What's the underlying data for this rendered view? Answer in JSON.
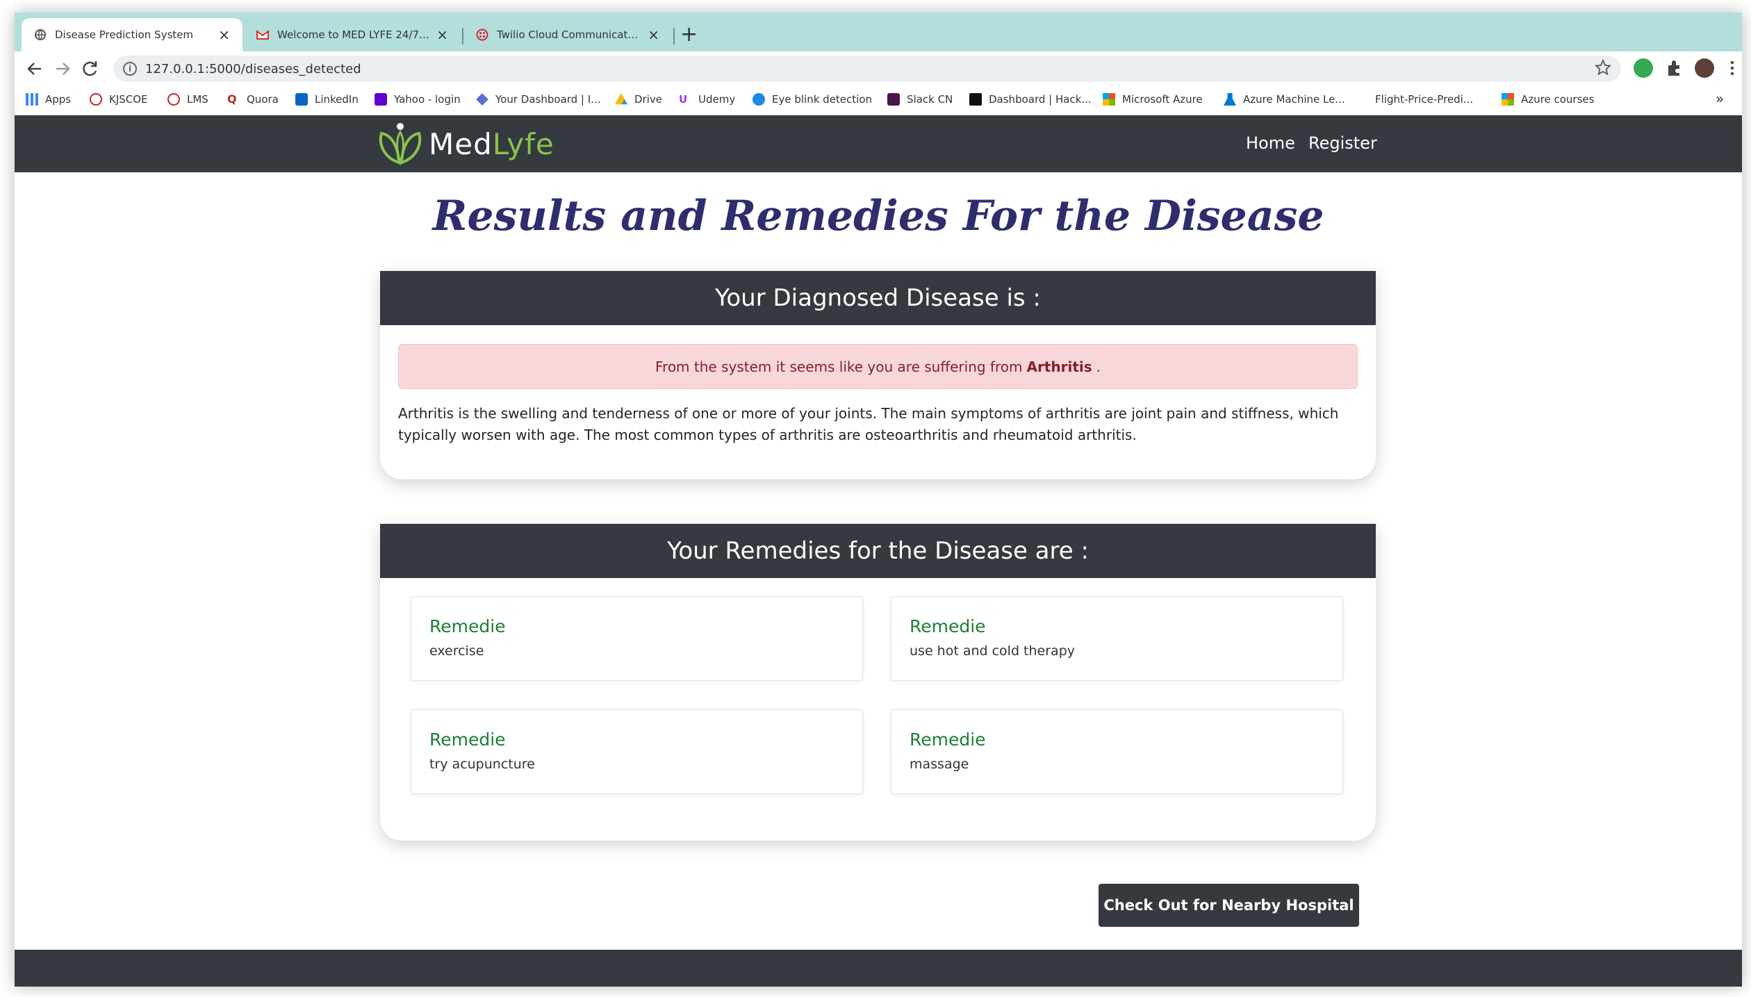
{
  "browser": {
    "tabs": [
      {
        "title": "Disease Prediction System"
      },
      {
        "title": "Welcome to MED LYFE 24/7 - I"
      },
      {
        "title": "Twilio Cloud Communications |"
      }
    ],
    "new_tab": "+",
    "close_glyph": "×",
    "url": "127.0.0.1:5000/diseases_detected",
    "bookmarks": [
      {
        "label": "Apps"
      },
      {
        "label": "KJSCOE"
      },
      {
        "label": "LMS"
      },
      {
        "label": "Quora"
      },
      {
        "label": "LinkedIn"
      },
      {
        "label": "Yahoo - login"
      },
      {
        "label": "Your Dashboard | I..."
      },
      {
        "label": "Drive"
      },
      {
        "label": "Udemy"
      },
      {
        "label": "Eye blink detection"
      },
      {
        "label": "Slack CN"
      },
      {
        "label": "Dashboard | Hack..."
      },
      {
        "label": "Microsoft Azure"
      },
      {
        "label": "Azure Machine Le..."
      },
      {
        "label": "Flight-Price-Predi..."
      },
      {
        "label": "Azure courses"
      }
    ],
    "more_bookmarks": "»"
  },
  "site": {
    "logo_part1": "Med",
    "logo_part2": "Lyfe",
    "nav_home": "Home",
    "nav_register": "Register"
  },
  "main": {
    "title": "Results and Remedies For the Disease",
    "diagnosis_header": "Your Diagnosed Disease is :",
    "alert_prefix": "From the system it seems like you are suffering from",
    "disease": "Arthritis",
    "alert_suffix": ".",
    "description": "Arthritis is the swelling and tenderness of one or more of your joints. The main symptoms of arthritis are joint pain and stiffness, which typically worsen with age. The most common types of arthritis are osteoarthritis and rheumatoid arthritis.",
    "remedies_header": "Your Remedies for the Disease are :",
    "remedies": [
      {
        "title": "Remedie",
        "value": "exercise"
      },
      {
        "title": "Remedie",
        "value": "use hot and cold therapy"
      },
      {
        "title": "Remedie",
        "value": "try acupuncture"
      },
      {
        "title": "Remedie",
        "value": "massage"
      }
    ],
    "hospital_button": "Check Out for Nearby Hospital"
  },
  "colors": {
    "dark": "#343a40",
    "tabstrip": "#b2dfdb",
    "title": "#2e2e6e",
    "remedy_title": "#1e7e34",
    "alert_bg": "#f8d7da",
    "logo_green": "#8bc34a"
  }
}
